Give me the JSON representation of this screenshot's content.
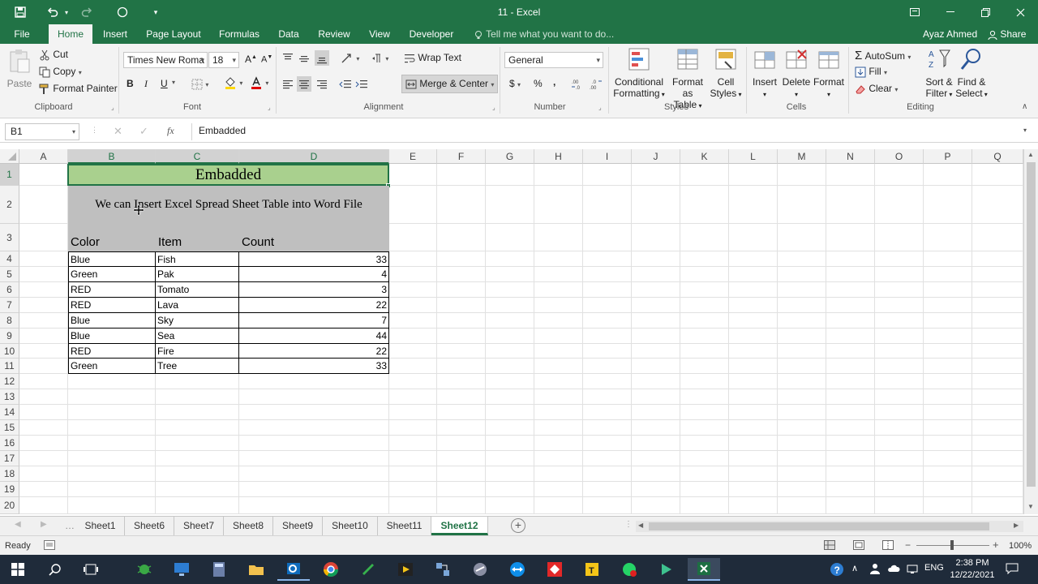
{
  "window": {
    "title": "11 - Excel"
  },
  "ribbon_tabs": [
    "File",
    "Home",
    "Insert",
    "Page Layout",
    "Formulas",
    "Data",
    "Review",
    "View",
    "Developer"
  ],
  "tell_me": "Tell me what you want to do...",
  "user": "Ayaz Ahmed",
  "share": "Share",
  "clipboard": {
    "paste": "Paste",
    "cut": "Cut",
    "copy": "Copy",
    "format_painter": "Format Painter",
    "label": "Clipboard"
  },
  "font": {
    "name": "Times New Roma",
    "size": "18",
    "bold": "B",
    "italic": "I",
    "underline": "U",
    "label": "Font"
  },
  "alignment": {
    "wrap_text": "Wrap Text",
    "merge_center": "Merge & Center",
    "label": "Alignment"
  },
  "number": {
    "format": "General",
    "currency": "$",
    "percent": "%",
    "comma": ",",
    "label": "Number"
  },
  "styles": {
    "conditional": [
      "Conditional",
      "Formatting"
    ],
    "format_table": [
      "Format as",
      "Table"
    ],
    "cell_styles": [
      "Cell",
      "Styles"
    ],
    "label": "Styles"
  },
  "cells": {
    "insert": "Insert",
    "delete": "Delete",
    "format": "Format",
    "label": "Cells"
  },
  "editing": {
    "autosum": "AutoSum",
    "fill": "Fill",
    "clear": "Clear",
    "sort_filter": [
      "Sort &",
      "Filter"
    ],
    "find_select": [
      "Find &",
      "Select"
    ],
    "label": "Editing"
  },
  "formula_bar": {
    "name_box": "B1",
    "fx": "fx",
    "value": "Embadded"
  },
  "columns": [
    "A",
    "B",
    "C",
    "D",
    "E",
    "F",
    "G",
    "H",
    "I",
    "J",
    "K",
    "L",
    "M",
    "N",
    "O",
    "P",
    "Q"
  ],
  "rows": [
    "1",
    "2",
    "3",
    "4",
    "5",
    "6",
    "7",
    "8",
    "9",
    "10",
    "11",
    "12",
    "13",
    "14",
    "15",
    "16",
    "17",
    "18",
    "19",
    "20"
  ],
  "sheet": {
    "title": "Embadded",
    "subtitle": "We can Insert Excel Spread Sheet Table into Word File",
    "headers": [
      "Color",
      "Item",
      "Count"
    ],
    "table": [
      [
        "Blue",
        "Fish",
        "33"
      ],
      [
        "Green",
        "Pak",
        "4"
      ],
      [
        "RED",
        "Tomato",
        "3"
      ],
      [
        "RED",
        "Lava",
        "22"
      ],
      [
        "Blue",
        "Sky",
        "7"
      ],
      [
        "Blue",
        "Sea",
        "44"
      ],
      [
        "RED",
        "Fire",
        "22"
      ],
      [
        "Green",
        "Tree",
        "33"
      ]
    ]
  },
  "sheet_tabs": [
    "Sheet1",
    "Sheet6",
    "Sheet7",
    "Sheet8",
    "Sheet9",
    "Sheet10",
    "Sheet11",
    "Sheet12"
  ],
  "active_sheet": "Sheet12",
  "status": {
    "ready": "Ready",
    "zoom": "100%"
  },
  "taskbar": {
    "lang": "ENG",
    "time": "2:38 PM",
    "date": "12/22/2021"
  },
  "colors": {
    "excel_green": "#217346",
    "title_fill": "#a9d08e",
    "header_fill": "#bfbfbf"
  }
}
